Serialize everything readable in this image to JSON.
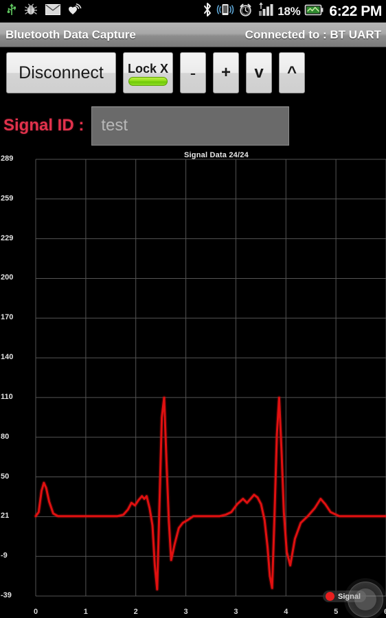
{
  "status_bar": {
    "icons": [
      "usb-icon",
      "debug-bug-icon",
      "email-icon",
      "heart-sync-icon"
    ],
    "right_icons": [
      "bluetooth-icon",
      "vibrate-icon",
      "alarm-clock-icon",
      "signal-bars-icon",
      "battery-icon"
    ],
    "battery_percent": "18%",
    "time": "6:22 PM"
  },
  "title_bar": {
    "app_title": "Bluetooth Data Capture",
    "connection_status": "Connected to : BT UART"
  },
  "toolbar": {
    "disconnect_label": "Disconnect",
    "lock_label": "Lock X",
    "lock_led_color": "#8ddd18",
    "minus_label": "-",
    "plus_label": "+",
    "down_label": "v",
    "up_label": "^"
  },
  "signal": {
    "label": "Signal ID :",
    "value": "test",
    "placeholder": "test"
  },
  "chart_data": {
    "type": "line",
    "title": "Signal Data 24/24",
    "xlabel": "",
    "ylabel": "",
    "grid": true,
    "legend_position": "bottom-right",
    "line_color": "#e01010",
    "background": "#000000",
    "grid_color": "#555555",
    "xlim": [
      0,
      6
    ],
    "ylim": [
      -39,
      289
    ],
    "xticks": [
      "0",
      "1",
      "2",
      "3",
      "3",
      "4",
      "5",
      "6"
    ],
    "yticks": [
      "289",
      "259",
      "229",
      "200",
      "170",
      "140",
      "110",
      "80",
      "50",
      "21",
      "-9",
      "-39"
    ],
    "series": [
      {
        "name": "Signal",
        "color": "#e01010",
        "x": [
          0.0,
          0.05,
          0.1,
          0.14,
          0.18,
          0.23,
          0.3,
          0.38,
          0.5,
          0.65,
          0.8,
          0.95,
          1.1,
          1.25,
          1.4,
          1.5,
          1.58,
          1.64,
          1.7,
          1.76,
          1.82,
          1.86,
          1.9,
          1.95,
          2.0,
          2.04,
          2.08,
          2.12,
          2.16,
          2.2,
          2.24,
          2.28,
          2.32,
          2.38,
          2.45,
          2.52,
          2.6,
          2.7,
          2.82,
          2.95,
          3.05,
          3.15,
          3.25,
          3.35,
          3.45,
          3.55,
          3.62,
          3.68,
          3.74,
          3.8,
          3.86,
          3.92,
          3.97,
          4.01,
          4.05,
          4.09,
          4.13,
          4.17,
          4.21,
          4.25,
          4.3,
          4.36,
          4.44,
          4.54,
          4.66,
          4.78,
          4.88,
          4.96,
          5.05,
          5.2,
          5.4,
          5.6,
          5.8,
          6.0
        ],
        "y": [
          21,
          24,
          40,
          46,
          42,
          32,
          23,
          21,
          21,
          21,
          21,
          21,
          21,
          21,
          21,
          22,
          26,
          31,
          29,
          33,
          36,
          34,
          36,
          27,
          14,
          -16,
          -34,
          30,
          95,
          110,
          62,
          18,
          -12,
          0,
          12,
          16,
          18,
          21,
          21,
          21,
          21,
          21,
          22,
          24,
          30,
          34,
          31,
          34,
          37,
          35,
          30,
          18,
          -2,
          -24,
          -33,
          20,
          82,
          110,
          70,
          24,
          -6,
          -16,
          4,
          16,
          21,
          27,
          34,
          30,
          24,
          21,
          21,
          21,
          21,
          21
        ],
        "description": "Two-beat ECG waveform with P, QRS, and T complexes on a 21-unit baseline"
      }
    ]
  },
  "legend": {
    "series_label": "Signal",
    "dot_color": "#e81f1f"
  },
  "overlay": {
    "zoom_handle": "zoom-pan-handle"
  }
}
